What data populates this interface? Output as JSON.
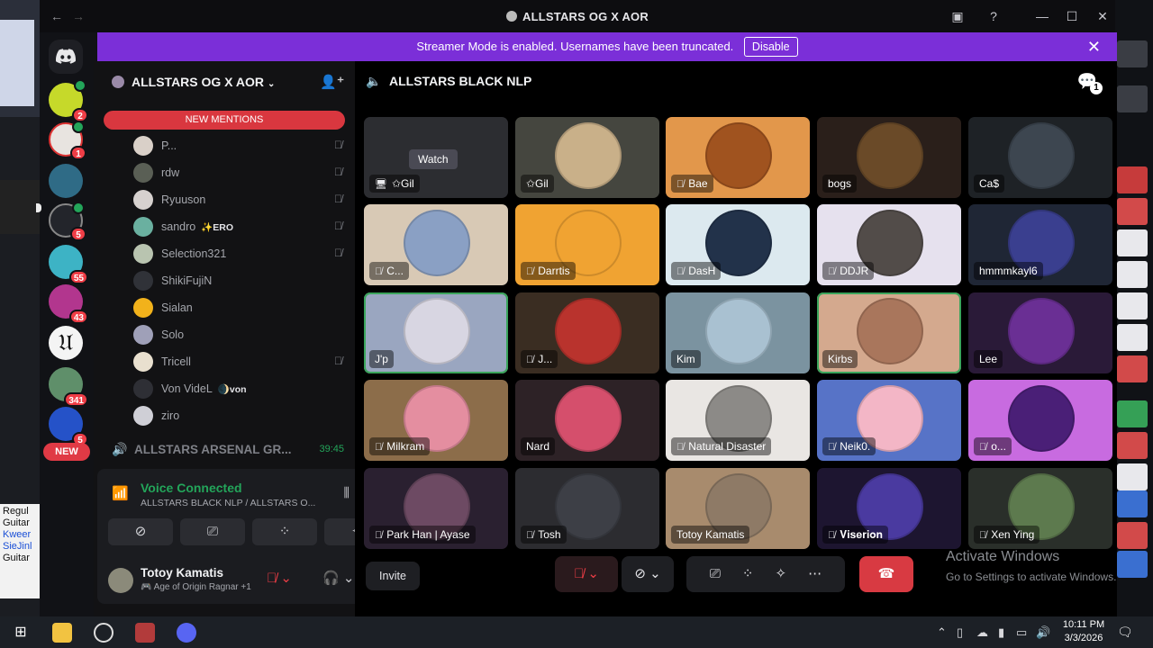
{
  "window": {
    "title": "ALLSTARS OG X AOR",
    "back": "←",
    "forward": "→"
  },
  "banner": {
    "text": "Streamer Mode is enabled. Usernames have been truncated.",
    "disable_label": "Disable",
    "close": "✕"
  },
  "rail": {
    "new_label": "NEW",
    "badges": [
      "2",
      "1",
      "",
      "5",
      "55",
      "43",
      "",
      "341",
      "5"
    ]
  },
  "sidebar": {
    "server_name": "ALLSTARS OG X AOR",
    "new_mentions": "NEW MENTIONS",
    "members": [
      {
        "name": "P...",
        "tag": "",
        "muted": true,
        "color": "#d9d0c8"
      },
      {
        "name": "rdw",
        "tag": "",
        "muted": true,
        "color": "#5a5f55"
      },
      {
        "name": "Ryuuson",
        "tag": "",
        "muted": true,
        "color": "#d6d1cf"
      },
      {
        "name": "sandro",
        "tag": "✨ERO",
        "muted": true,
        "color": "#6ab0a0"
      },
      {
        "name": "Selection321",
        "tag": "",
        "muted": true,
        "color": "#b9c4b0"
      },
      {
        "name": "ShikiFujiN",
        "tag": "",
        "muted": false,
        "color": "#303238"
      },
      {
        "name": "Sialan",
        "tag": "",
        "muted": false,
        "color": "#f2b21b"
      },
      {
        "name": "Solo",
        "tag": "",
        "muted": false,
        "color": "#9fa0b8"
      },
      {
        "name": "Tricell",
        "tag": "",
        "muted": true,
        "color": "#e9e0cf"
      },
      {
        "name": "Von VideL",
        "tag": "🌒von",
        "muted": false,
        "color": "#2e2f35"
      },
      {
        "name": "ziro",
        "tag": "",
        "muted": false,
        "color": "#cfcfd6"
      }
    ],
    "channel2_name": "ALLSTARS ARSENAL GR...",
    "channel2_time": "39:45"
  },
  "voice": {
    "status": "Voice Connected",
    "location": "ALLSTARS BLACK NLP / ALLSTARS O...",
    "user_name": "Totoy Kamatis",
    "user_status": "🎮 Age of Origin Ragnar +1"
  },
  "stage": {
    "channel_name": "ALLSTARS BLACK NLP",
    "chat_badge": "1",
    "watch_label": "Watch",
    "tiles": [
      {
        "label": "✩Gil",
        "muted": false,
        "stream": true,
        "bg": "#2c2d31",
        "av": "#3a3c42"
      },
      {
        "label": "✩Gil",
        "muted": false,
        "stream": false,
        "bg": "#45463f",
        "av": "#c9b089"
      },
      {
        "label": "Bae",
        "muted": true,
        "stream": false,
        "bg": "#e2974b",
        "av": "#a0531f"
      },
      {
        "label": "bogs",
        "muted": false,
        "stream": false,
        "bg": "#2a1f1a",
        "av": "#6a4a28"
      },
      {
        "label": "Ca$",
        "muted": false,
        "stream": false,
        "bg": "#1e2226",
        "av": "#3d4650"
      },
      {
        "label": "C...",
        "muted": true,
        "stream": false,
        "bg": "#d8c9b5",
        "av": "#8aa0c4"
      },
      {
        "label": "Darrtis",
        "muted": true,
        "stream": false,
        "bg": "#f0a332",
        "av": "#f0a332"
      },
      {
        "label": "DasH",
        "muted": true,
        "stream": false,
        "bg": "#dce9ef",
        "av": "#22324a"
      },
      {
        "label": "DDJR",
        "muted": true,
        "stream": false,
        "bg": "#e6e1ee",
        "av": "#524c49"
      },
      {
        "label": "hmmmkayl6",
        "muted": false,
        "stream": false,
        "bg": "#1f2635",
        "av": "#3a3f8f"
      },
      {
        "label": "J'p",
        "muted": false,
        "stream": false,
        "bg": "#9aa6c0",
        "av": "#d8d6e2",
        "speaking": true
      },
      {
        "label": "J...",
        "muted": true,
        "stream": false,
        "bg": "#3a2d22",
        "av": "#b9332d"
      },
      {
        "label": "Kim",
        "muted": false,
        "stream": false,
        "bg": "#7b93a0",
        "av": "#a9c1d1"
      },
      {
        "label": "Kirbs",
        "muted": false,
        "stream": false,
        "bg": "#d4a98e",
        "av": "#a9765c",
        "speaking": true
      },
      {
        "label": "Lee",
        "muted": false,
        "stream": false,
        "bg": "#2a1a38",
        "av": "#6a2f94"
      },
      {
        "label": "Milkram",
        "muted": true,
        "stream": false,
        "bg": "#8c6d4a",
        "av": "#e48ea0"
      },
      {
        "label": "Nard",
        "muted": false,
        "stream": false,
        "bg": "#2d2226",
        "av": "#d54f6c"
      },
      {
        "label": "Natural Disaster",
        "muted": true,
        "stream": false,
        "bg": "#e9e6e3",
        "av": "#8c8a87"
      },
      {
        "label": "Neik0.",
        "muted": true,
        "stream": false,
        "bg": "#5773c7",
        "av": "#f3b6c6"
      },
      {
        "label": "o...",
        "muted": true,
        "stream": false,
        "bg": "#c86be0",
        "av": "#4a1f77"
      },
      {
        "label": "Park Han | Ayase",
        "muted": true,
        "stream": false,
        "bg": "#2a2030",
        "av": "#6d4a63"
      },
      {
        "label": "Tosh",
        "muted": true,
        "stream": false,
        "bg": "#2c2c30",
        "av": "#3d3f46"
      },
      {
        "label": "Totoy Kamatis",
        "muted": false,
        "stream": false,
        "bg": "#a88b6d",
        "av": "#8e7a66"
      },
      {
        "label": "𝐕𝐢𝐬𝐞𝐫𝐢𝐨𝐧",
        "muted": true,
        "stream": false,
        "bg": "#1d1530",
        "av": "#4a3aa0"
      },
      {
        "label": "Xen Ying",
        "muted": true,
        "stream": false,
        "bg": "#2a2f2a",
        "av": "#5d7a4e"
      }
    ],
    "invite_label": "Invite"
  },
  "watermark": {
    "line1": "Activate Windows",
    "line2": "Go to Settings to activate Windows."
  },
  "taskbar": {
    "time": "10:11 PM",
    "date": "3/3/2026"
  },
  "desktop": {
    "notes": [
      "Regul",
      "Guitar",
      "Kweer",
      "SieJinl",
      "Guitar"
    ]
  }
}
